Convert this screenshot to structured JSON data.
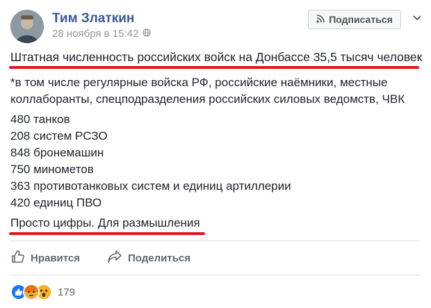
{
  "post": {
    "author": "Тим Златкин",
    "date": "28 ноября в 15:42",
    "subscribe_label": "Подписаться",
    "headline": "Штатная численность российских войск на Донбассе 35,5 тысяч человек",
    "note_line1": "*в том числе регулярные войска РФ, российские наёмники, местные",
    "note_line2": "коллаборанты, спецподразделения российских силовых ведомств, ЧВК",
    "stats": [
      "480 танков",
      "208 систем РСЗО",
      "848 бронемашин",
      "750 минометов",
      "363 противотанковых систем и единиц артиллерии",
      "420 единиц ПВО"
    ],
    "closing": "Просто цифры. Для размышления",
    "like_label": "Нравится",
    "share_label": "Поделиться",
    "reaction_count": "179"
  },
  "colors": {
    "author_link": "#385898",
    "underline": "#e0151f",
    "reaction_like": "#1877f2",
    "reaction_angry": "#e9710f",
    "reaction_wow": "#f7b125"
  },
  "icons": [
    "privacy-globe-icon",
    "rss-icon",
    "more-icon",
    "like-icon",
    "share-icon",
    "like-reaction-icon",
    "angry-reaction-icon",
    "wow-reaction-icon"
  ]
}
